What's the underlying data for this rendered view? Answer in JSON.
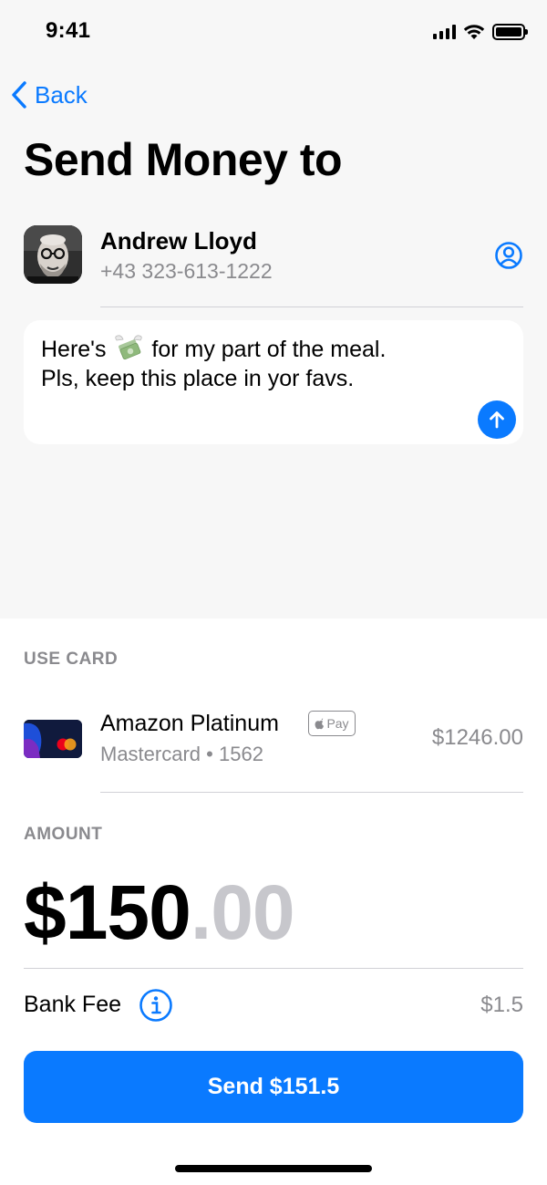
{
  "status_bar": {
    "time": "9:41"
  },
  "nav": {
    "back_label": "Back"
  },
  "header": {
    "title": "Send Money to"
  },
  "recipient": {
    "name": "Andrew Lloyd",
    "phone": "+43 323-613-1222"
  },
  "message": {
    "line1_before": "Here's",
    "line1_after": "for my part of the meal.",
    "line2": "Pls, keep this place in yor favs.",
    "emoji": "money-with-wings-icon"
  },
  "card_section": {
    "label": "USE CARD",
    "card_name": "Amazon Platinum",
    "badge": "Pay",
    "card_type": "Mastercard",
    "card_last4": "1562",
    "balance": "$1246.00"
  },
  "amount_section": {
    "label": "AMOUNT",
    "amount_integer": "$150",
    "amount_decimal": ".00"
  },
  "fee": {
    "label": "Bank Fee",
    "value": "$1.5"
  },
  "send_button": {
    "label": "Send $151.5"
  },
  "colors": {
    "accent": "#0a7aff",
    "secondary_text": "#8a8a8e",
    "top_background": "#f7f7f7"
  }
}
